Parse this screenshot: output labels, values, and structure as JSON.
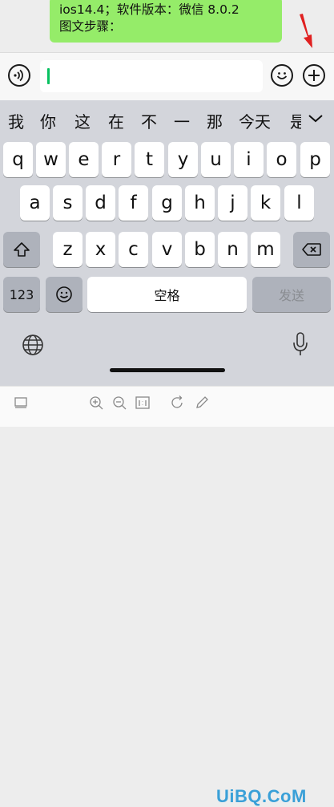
{
  "chat": {
    "bubble_line1": "ios14.4；软件版本：微信 8.0.2",
    "bubble_line2": "图文步骤："
  },
  "input": {
    "value": "",
    "voice_icon": "voice-icon",
    "emoji_icon": "emoji-icon",
    "plus_icon": "plus-icon"
  },
  "suggestions": [
    "我",
    "你",
    "这",
    "在",
    "不",
    "一",
    "那",
    "今天",
    "是"
  ],
  "keyboard": {
    "row1": [
      "q",
      "w",
      "e",
      "r",
      "t",
      "y",
      "u",
      "i",
      "o",
      "p"
    ],
    "row2": [
      "a",
      "s",
      "d",
      "f",
      "g",
      "h",
      "j",
      "k",
      "l"
    ],
    "row3": [
      "z",
      "x",
      "c",
      "v",
      "b",
      "n",
      "m"
    ],
    "numbers_label": "123",
    "space_label": "空格",
    "send_label": "发送"
  },
  "colors": {
    "accent": "#07c160",
    "bubble": "#95ec69",
    "arrow": "#e02020"
  },
  "watermark": "UiBQ.CoM"
}
